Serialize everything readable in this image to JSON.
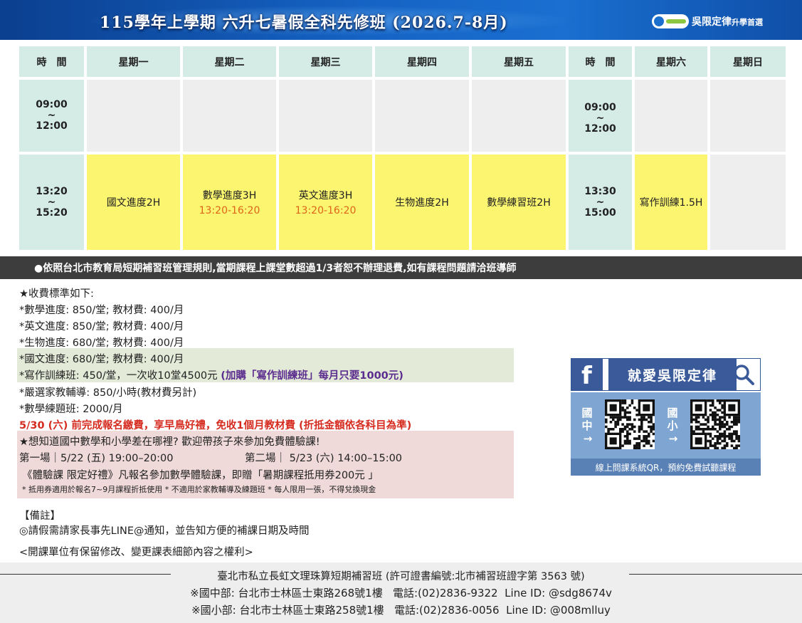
{
  "header": {
    "title": "115學年上學期  六升七暑假全科先修班 (2026.7-8月)",
    "brand_name": "吳限定律",
    "brand_tag": "升學首選"
  },
  "schedule": {
    "headers": [
      "時　間",
      "星期一",
      "星期二",
      "星期三",
      "星期四",
      "星期五",
      "時　間",
      "星期六",
      "星期日"
    ],
    "morning_time": [
      "09:00",
      "~",
      "12:00"
    ],
    "afternoon_time": [
      "13:20",
      "~",
      "15:20"
    ],
    "weekend_morning_time": [
      "09:00",
      "~",
      "12:00"
    ],
    "weekend_afternoon_time": [
      "13:30",
      "~",
      "15:00"
    ],
    "mon_pm": "國文進度2H",
    "tue_pm": "數學進度3H",
    "tue_pm_time": "13:20-16:20",
    "wed_pm": "英文進度3H",
    "wed_pm_time": "13:20-16:20",
    "thu_pm": "生物進度2H",
    "fri_pm": "數學練習班2H",
    "sat_pm": "寫作訓練1.5H"
  },
  "notice": "●依照台北市教育局短期補習班管理規則,當期課程上課堂數超過1/3者恕不辦理退費,如有課程問題請洽班導師",
  "fees": {
    "title": "★收費標準如下:",
    "math": "*數學進度: 850/堂; 教材費: 400/月",
    "english": "*英文進度: 850/堂; 教材費: 400/月",
    "biology": "*生物進度: 680/堂; 教材費: 400/月",
    "chinese": "*國文進度: 680/堂; 教材費: 400/月",
    "writing": "*寫作訓練班: 450/堂，一次收10堂4500元",
    "writing_promo": "(加購「寫作訓練班」每月只要1000元)",
    "tutor": "*嚴選家教輔導: 850/小時(教材費另計)",
    "practice": "*數學練題班: 2000/月",
    "early_bird": "5/30 (六) 前完成報名繳費，享早鳥好禮，免收1個月教材費 (折抵金額依各科目為準)"
  },
  "trial": {
    "title": "★想知道國中數學和小學差在哪裡? 歡迎帶孩子來參加免費體驗課!",
    "session1": "第一場｜5/22 (五) 19:00–20:00",
    "session2": "第二場｜ 5/23 (六) 14:00–15:00",
    "offer": "《體驗課 限定好禮》凡報名參加數學體驗課，即贈「暑期課程抵用券200元 」",
    "fineprint": "* 抵用券適用於報名7~9月課程折抵使用  * 不適用於家教輔導及練題班  * 每人限用一張，不得兌換現金"
  },
  "remarks": {
    "title": "【備註】",
    "line1": "◎請假需請家長事先LINE@通知，並告知方便的補課日期及時間",
    "rights": "<開課單位有保留修改、變更課表細節內容之權利>"
  },
  "facebook": {
    "name": "就愛吳限定律",
    "junior_label": "國中",
    "elementary_label": "國小",
    "caption": "線上問課系統QR，預約免費試聽課程"
  },
  "footer": {
    "title": "臺北市私立長虹文理珠算短期補習班 (許可證書編號:北市補習班證字第 3563 號)",
    "junior_branch": "※國中部: 台北市士林區士東路268號1樓   電話:(02)2836-9322  Line ID: @sdg8674v",
    "elementary_branch": "※國小部: 台北市士林區士東路258號1樓   電話:(02)2836-0056  Line ID: @008mlluy"
  },
  "colors": {
    "header_blue": "#1563c4",
    "teal_cell": "#d4ebe6",
    "yellow_cell": "#fbf56f",
    "orange_text": "#e0641b",
    "purple_text": "#5b2d8e",
    "red_text": "#d62b1f",
    "facebook_blue": "#3b5a9a"
  }
}
